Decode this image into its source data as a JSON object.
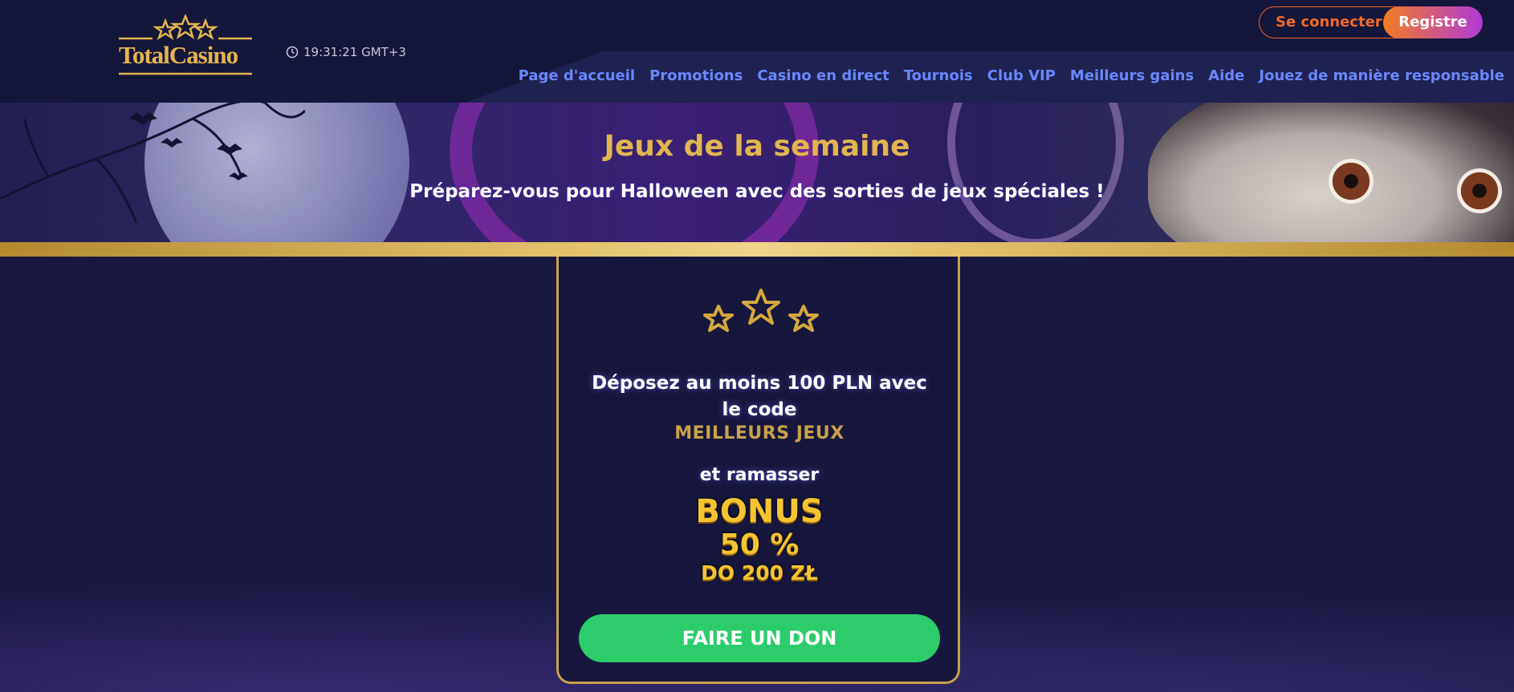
{
  "brand": {
    "logo_text": "TotalCasino",
    "gold": "#e1b64e",
    "accent_orange": "#ef6a2b",
    "accent_green": "#2dcc6b",
    "nav_color": "#6a87ff"
  },
  "header": {
    "clock_time": "19:31:21 GMT+3",
    "login_label": "Se connecter",
    "register_label": "Registre",
    "nav": [
      "Page d'accueil",
      "Promotions",
      "Casino en direct",
      "Tournois",
      "Club VIP",
      "Meilleurs gains",
      "Aide",
      "Jouez de manière responsable"
    ]
  },
  "hero": {
    "title": "Jeux de la semaine",
    "subtitle": "Préparez-vous pour Halloween avec des sorties de jeux spéciales !"
  },
  "card": {
    "offer_text": "Déposez au moins 100 PLN avec le code",
    "promo_code": "MEILLEURS JEUX",
    "collect_text": "et ramasser",
    "bonus_line1": "BONUS",
    "bonus_line2": "50 %",
    "bonus_line3": "DO 200 ZŁ",
    "cta_label": "FAIRE UN DON"
  }
}
